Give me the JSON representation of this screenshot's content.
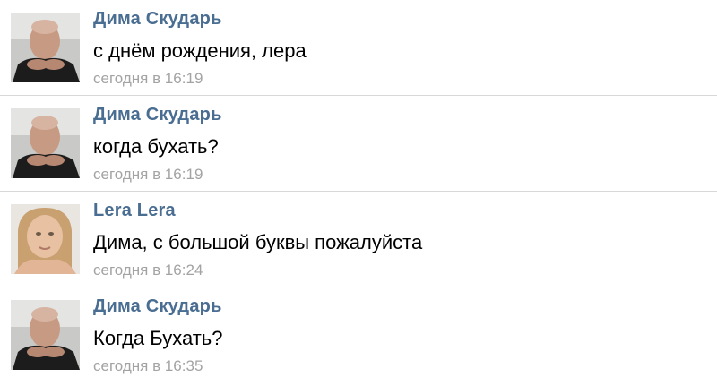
{
  "messages": [
    {
      "author": "Дима Скударь",
      "text": "с днём рождения, лера",
      "time": "сегодня в 16:19",
      "avatar_icon": "man-portrait-avatar"
    },
    {
      "author": "Дима Скударь",
      "text": "когда бухать?",
      "time": "сегодня в 16:19",
      "avatar_icon": "man-portrait-avatar"
    },
    {
      "author": "Lera Lera",
      "text": "Дима, с большой буквы пожалуйста",
      "time": "сегодня в 16:24",
      "avatar_icon": "woman-portrait-avatar"
    },
    {
      "author": "Дима Скударь",
      "text": "Когда Бухать?",
      "time": "сегодня в 16:35",
      "avatar_icon": "man-portrait-avatar"
    }
  ],
  "colors": {
    "author": "#4a6d92",
    "text": "#000000",
    "time": "#a3a3a3",
    "divider": "#d8d8d8",
    "background": "#ffffff"
  }
}
